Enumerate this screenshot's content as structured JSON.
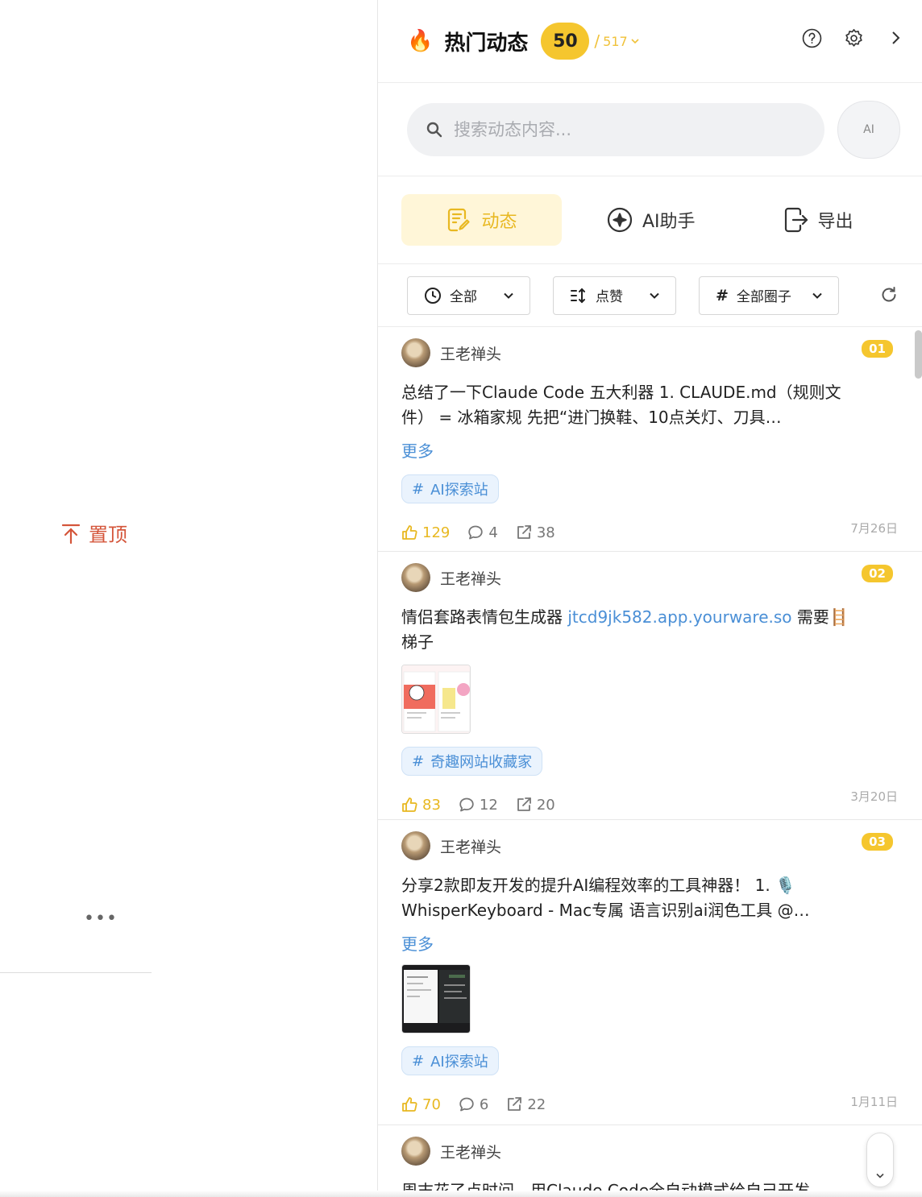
{
  "left": {
    "pin_label": "置顶",
    "more_dots": "•••"
  },
  "header": {
    "icon": "fire-emoji",
    "flame": "🔥",
    "title": "热门动态",
    "count": "50",
    "separator": "/",
    "total": "517"
  },
  "search": {
    "placeholder": "搜索动态内容...",
    "ai_label": "AI"
  },
  "tabs": [
    {
      "label": "动态",
      "icon": "notes-icon",
      "active": true
    },
    {
      "label": "AI助手",
      "icon": "sparkle-icon",
      "active": false
    },
    {
      "label": "导出",
      "icon": "export-icon",
      "active": false
    }
  ],
  "filters": {
    "time": "全部",
    "sort": "点赞",
    "circle": "全部圈子"
  },
  "posts": [
    {
      "author": "王老禅头",
      "rank": "01",
      "text": "总结了一下Claude Code 五大利器 1. CLAUDE.md（规则文件） = 冰箱家规 先把“进门换鞋、10点关灯、刀具…",
      "more": "更多",
      "tag": "AI探索站",
      "likes": "129",
      "comments": "4",
      "shares": "38",
      "date": "7月26日"
    },
    {
      "author": "王老禅头",
      "rank": "02",
      "text_before": "情侣套路表情包生成器 ",
      "link": "jtcd9jk582.app.yourware.so",
      "text_after": " 需要🪜梯子",
      "tag": "奇趣网站收藏家",
      "likes": "83",
      "comments": "12",
      "shares": "20",
      "date": "3月20日"
    },
    {
      "author": "王老禅头",
      "rank": "03",
      "text": "分享2款即友开发的提升AI编程效率的工具神器！ 1. 🎙️ WhisperKeyboard - Mac专属 语言识别ai润色工具 @…",
      "more": "更多",
      "tag": "AI探索站",
      "likes": "70",
      "comments": "6",
      "shares": "22",
      "date": "1月11日"
    },
    {
      "author": "王老禅头",
      "text": "周末花了点时间，用Claude Code全自动模式给自己开发"
    }
  ],
  "colors": {
    "accent": "#f5c62e",
    "link": "#4a8fd6",
    "pin": "#d4553a"
  }
}
